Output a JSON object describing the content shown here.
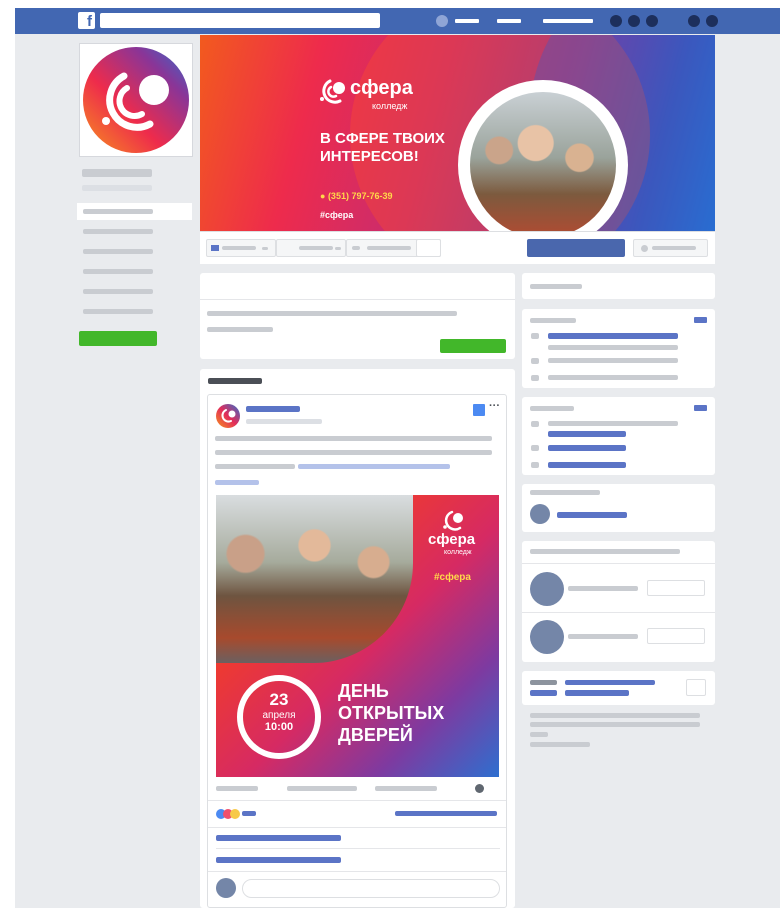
{
  "topnav": {
    "logo": "f"
  },
  "brand": {
    "name": "сфера",
    "subtitle": "колледж"
  },
  "cover": {
    "headline_line1": "В СФЕРЕ ТВОИХ",
    "headline_line2": "ИНТЕРЕСОВ!",
    "phone": "(351) 797-76-39",
    "hashtag": "#сфера"
  },
  "post": {
    "hashtag": "#сфера",
    "date_day": "23",
    "date_month": "апреля",
    "date_time": "10:00",
    "headline_line1": "ДЕНЬ",
    "headline_line2": "ОТКРЫТЫХ",
    "headline_line3": "ДВЕРЕЙ"
  },
  "colors": {
    "facebook_blue": "#4267b2",
    "page_bg": "#e9ebee",
    "link_blue": "#5b74c6",
    "cta_green": "#42b72a",
    "brand_orange": "#f25a1e",
    "brand_purple": "#8a3597"
  },
  "icons": {
    "logo": "facebook-logo-icon",
    "phone": "phone-icon",
    "more": "ellipsis-icon"
  }
}
